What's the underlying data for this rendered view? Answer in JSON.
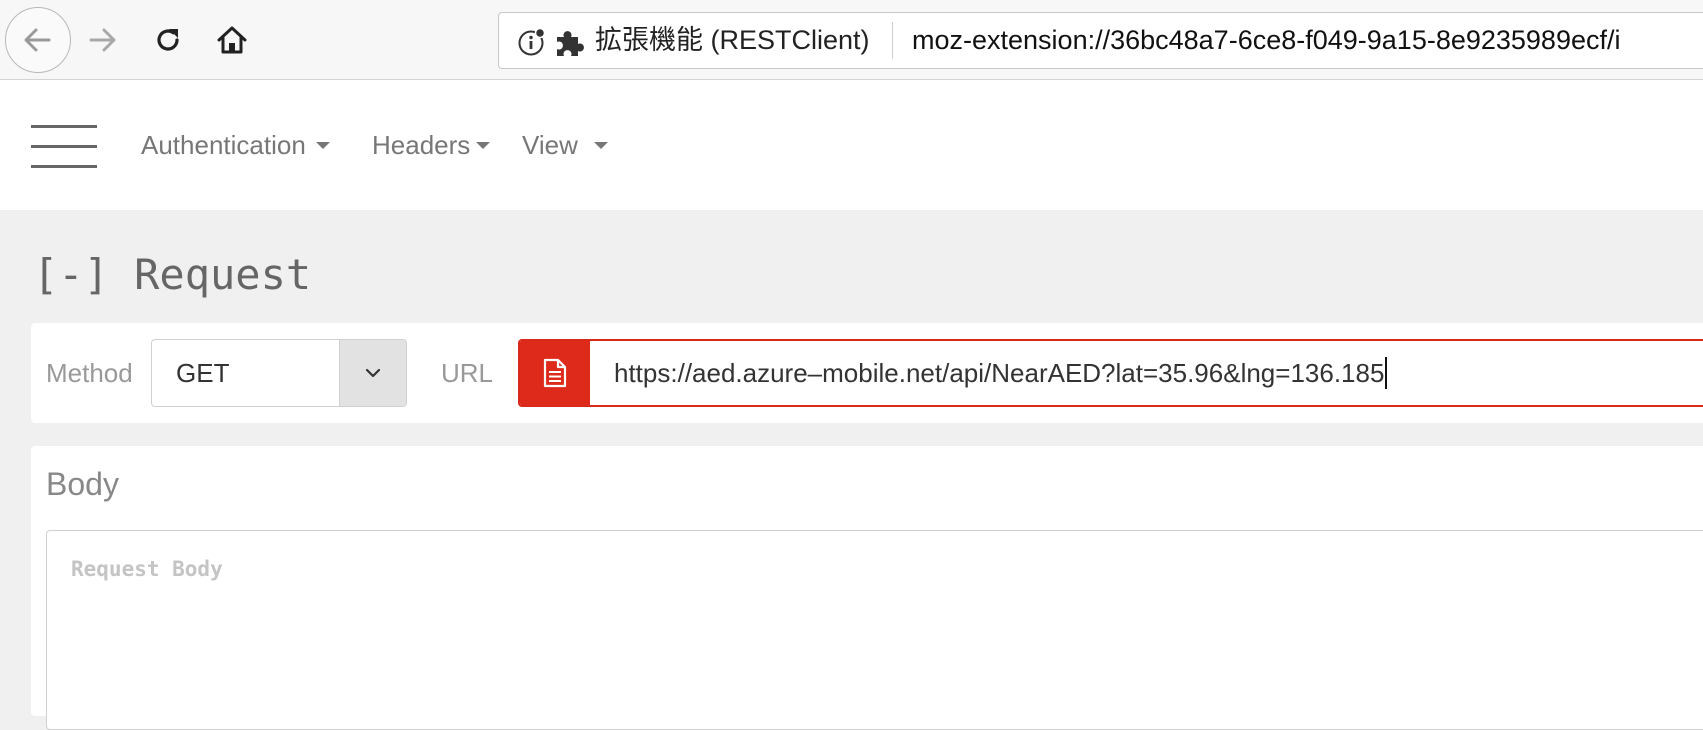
{
  "browser": {
    "identity_label": "拡張機能 (RESTClient)",
    "address": "moz-extension://36bc48a7-6ce8-f049-9a15-8e9235989ecf/i"
  },
  "nav": {
    "menus": [
      {
        "label": "Authentication"
      },
      {
        "label": "Headers"
      },
      {
        "label": "View"
      }
    ]
  },
  "request": {
    "title": "[-] Request",
    "method_label": "Method",
    "method_value": "GET",
    "url_label": "URL",
    "url_value": "https://aed.azure–mobile.net/api/NearAED?lat=35.96&lng=136.185"
  },
  "body": {
    "title": "Body",
    "placeholder": "Request Body"
  },
  "colors": {
    "accent": "#dd2a1a",
    "background": "#f0f0f0"
  },
  "icons": {
    "back": "arrow-left-icon",
    "forward": "arrow-right-icon",
    "reload": "reload-icon",
    "home": "home-icon",
    "info": "info-icon",
    "extension": "puzzle-icon",
    "menu": "hamburger-icon",
    "method_toggle": "chevron-down-icon",
    "url_addon": "document-icon"
  }
}
